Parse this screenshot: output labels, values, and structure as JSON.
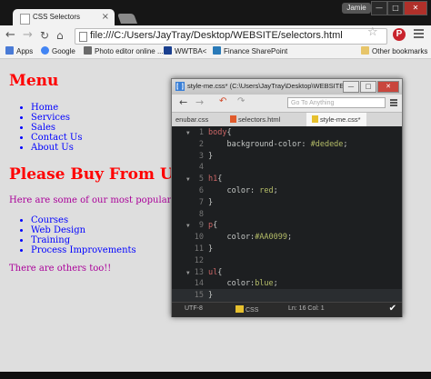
{
  "browser": {
    "tab_title": "CSS Selectors",
    "tab_close": "×",
    "user_name": "Jamie",
    "url": "file:///C:/Users/JayTray/Desktop/WEBSITE/selectors.html",
    "bookmarks": [
      {
        "label": "Apps",
        "color": "#4a7bd6"
      },
      {
        "label": "Google",
        "color": "#4285f4"
      },
      {
        "label": "Photo editor online ...",
        "color": "#6a6a6a"
      },
      {
        "label": "WWTBA<",
        "color": "#1a3f8f"
      },
      {
        "label": "Finance SharePoint",
        "color": "#2a7ab8"
      }
    ],
    "other_bookmarks": "Other bookmarks"
  },
  "page": {
    "menu_heading": "Menu",
    "menu_items": [
      "Home",
      "Services",
      "Sales",
      "Contact Us",
      "About Us"
    ],
    "buy_heading": "Please Buy From Us",
    "popular_text": "Here are some of our most popular products",
    "products": [
      "Courses",
      "Web Design",
      "Training",
      "Process Improvements"
    ],
    "others_text": "There are others too!!"
  },
  "editor": {
    "window_title": "style-me.css* (C:\\Users\\JayTray\\Desktop\\WEBSITE\\CSS) -...",
    "goto_placeholder": "Go To Anything",
    "tabs": [
      "enubar.css",
      "selectors.html",
      "style-me.css*"
    ],
    "code_lines": [
      {
        "n": "1",
        "fold": true,
        "parts": [
          [
            "t-sel",
            "body"
          ],
          [
            "t-brace",
            "{"
          ]
        ]
      },
      {
        "n": "2",
        "fold": false,
        "parts": [
          [
            "t-prop",
            "    background-color: "
          ],
          [
            "t-val",
            "#dedede"
          ],
          [
            "t-prop",
            ";"
          ]
        ]
      },
      {
        "n": "3",
        "fold": false,
        "parts": [
          [
            "t-brace",
            "}"
          ]
        ]
      },
      {
        "n": "4",
        "fold": false,
        "parts": []
      },
      {
        "n": "5",
        "fold": true,
        "parts": [
          [
            "t-sel",
            "h1"
          ],
          [
            "t-brace",
            "{"
          ]
        ]
      },
      {
        "n": "6",
        "fold": false,
        "parts": [
          [
            "t-prop",
            "    color: "
          ],
          [
            "t-val",
            "red"
          ],
          [
            "t-prop",
            ";"
          ]
        ]
      },
      {
        "n": "7",
        "fold": false,
        "parts": [
          [
            "t-brace",
            "}"
          ]
        ]
      },
      {
        "n": "8",
        "fold": false,
        "parts": []
      },
      {
        "n": "9",
        "fold": true,
        "parts": [
          [
            "t-sel",
            "p"
          ],
          [
            "t-brace",
            "{"
          ]
        ]
      },
      {
        "n": "10",
        "fold": false,
        "parts": [
          [
            "t-prop",
            "    color:"
          ],
          [
            "t-val",
            "#AA0099"
          ],
          [
            "t-prop",
            ";"
          ]
        ]
      },
      {
        "n": "11",
        "fold": false,
        "parts": [
          [
            "t-brace",
            "}"
          ]
        ]
      },
      {
        "n": "12",
        "fold": false,
        "parts": []
      },
      {
        "n": "13",
        "fold": true,
        "parts": [
          [
            "t-sel",
            "ul"
          ],
          [
            "t-brace",
            "{"
          ]
        ]
      },
      {
        "n": "14",
        "fold": false,
        "parts": [
          [
            "t-prop",
            "    color:"
          ],
          [
            "t-val",
            "blue"
          ],
          [
            "t-prop",
            ";"
          ]
        ]
      },
      {
        "n": "15",
        "fold": false,
        "parts": [
          [
            "t-brace",
            "}"
          ]
        ]
      }
    ],
    "status_encoding": "UTF-8",
    "status_language": "CSS",
    "status_position": "Ln: 16 Col: 1"
  },
  "colors": {
    "heading": "#ff0000",
    "paragraph": "#AA0099",
    "list": "#0000ff",
    "page_bg": "#dedede"
  }
}
